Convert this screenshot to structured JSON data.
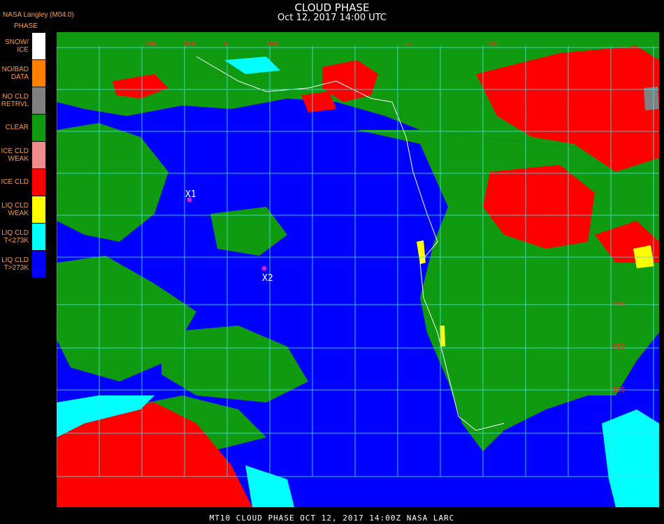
{
  "header": {
    "title": "CLOUD PHASE",
    "subtitle": "Oct 12, 2017 14:00 UTC",
    "producer": "NASA Langley (M04.0)"
  },
  "legend": {
    "heading": "PHASE",
    "items": [
      {
        "label": "SNOW/\nICE",
        "color": "#ffffff"
      },
      {
        "label": "NO/BAD\nDATA",
        "color": "#ff8000"
      },
      {
        "label": "NO CLD\nRETRVL",
        "color": "#808080"
      },
      {
        "label": "CLEAR",
        "color": "#109a10"
      },
      {
        "label": "ICE CLD\nWEAK",
        "color": "#f08c8c"
      },
      {
        "label": "ICE CLD",
        "color": "#ff0000"
      },
      {
        "label": "LIQ CLD\nWEAK",
        "color": "#ffff00"
      },
      {
        "label": "LIQ CLD\nT<273K",
        "color": "#00ffff"
      },
      {
        "label": "LIQ CLD\nT>273K",
        "color": "#0000ff"
      }
    ]
  },
  "map": {
    "markers": [
      {
        "name": "marker-x1",
        "label": "X1"
      },
      {
        "name": "marker-x2",
        "label": "X2"
      }
    ],
    "lon_labels": [
      "20W",
      "10W",
      "0",
      "10E",
      "15E",
      "20E"
    ],
    "lat_labels": [
      "20S",
      "25S",
      "30S"
    ]
  },
  "footer": {
    "text": "MT10  CLOUD PHASE   OCT 12, 2017 14:00Z   NASA LARC"
  }
}
